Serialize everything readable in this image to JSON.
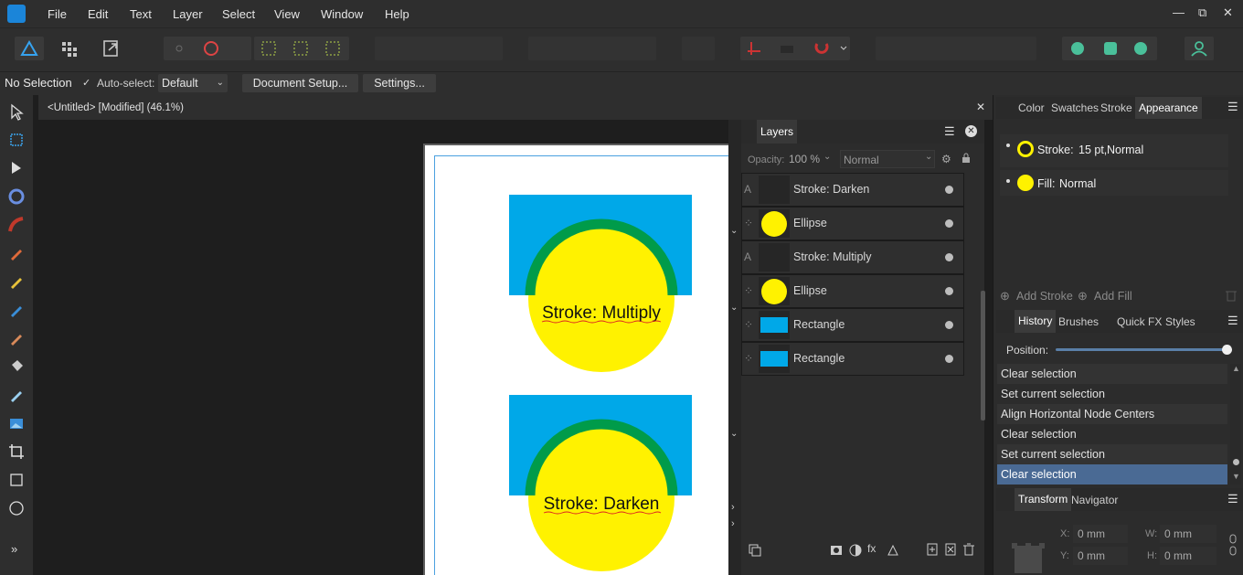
{
  "menu": {
    "items": [
      "File",
      "Edit",
      "Text",
      "Layer",
      "Select",
      "View",
      "Window",
      "Help"
    ],
    "window_controls": [
      "—",
      "⧉",
      "✕"
    ]
  },
  "context_bar": {
    "selection_status": "No Selection",
    "auto_select_label": "Auto-select:",
    "auto_select_checked": true,
    "auto_select_value": "Default",
    "document_setup_label": "Document Setup...",
    "settings_label": "Settings..."
  },
  "document_tab": {
    "title": "<Untitled> [Modified] (46.1%)",
    "close_glyph": "✕"
  },
  "canvas": {
    "shapes": [
      {
        "label": "Stroke: Multiply",
        "rect_color": "#00a8e8",
        "circle_color": "#fff200",
        "stroke_color": "#009b4a"
      },
      {
        "label": "Stroke: Darken",
        "rect_color": "#00a8e8",
        "circle_color": "#fff200",
        "stroke_color": "#009b4a"
      }
    ]
  },
  "layers_panel": {
    "title": "Layers",
    "opacity_label": "Opacity:",
    "opacity_value": "100 %",
    "blend_mode": "Normal",
    "rows": [
      {
        "type_glyph": "A",
        "name": "Stroke: Darken",
        "thumb": "text"
      },
      {
        "type_glyph": "⁘",
        "name": "Ellipse",
        "thumb": "ellipse"
      },
      {
        "type_glyph": "A",
        "name": "Stroke: Multiply",
        "thumb": "text"
      },
      {
        "type_glyph": "⁘",
        "name": "Ellipse",
        "thumb": "ellipse"
      },
      {
        "type_glyph": "⁘",
        "name": "Rectangle",
        "thumb": "rect"
      },
      {
        "type_glyph": "⁘",
        "name": "Rectangle",
        "thumb": "rect"
      }
    ]
  },
  "appearance_panel": {
    "tabs": [
      "Color",
      "Swatches",
      "Stroke",
      "Appearance"
    ],
    "active_tab": "Appearance",
    "stroke_label": "Stroke:",
    "stroke_value": "15 pt,",
    "stroke_mode": "Normal",
    "fill_label": "Fill:",
    "fill_mode": "Normal",
    "add_stroke_label": "Add Stroke",
    "add_fill_label": "Add Fill"
  },
  "history_panel": {
    "tabs": [
      "History",
      "Brushes",
      "Quick FX",
      "Styles"
    ],
    "active_tab": "History",
    "position_label": "Position:",
    "position_fraction": 1.0,
    "entries": [
      "Clear selection",
      "Set current selection",
      "Align Horizontal Node Centers",
      "Clear selection",
      "Set current selection",
      "Clear selection"
    ],
    "selected_index": 5
  },
  "transform_panel": {
    "tabs": [
      "Transform",
      "Navigator"
    ],
    "active_tab": "Transform",
    "x_label": "X:",
    "x_value": "0 mm",
    "y_label": "Y:",
    "y_value": "0 mm",
    "w_label": "W:",
    "w_value": "0 mm",
    "h_label": "H:",
    "h_value": "0 mm"
  },
  "colors": {
    "accent": "#4a6a94",
    "panel_bg": "#2c2c2c",
    "yellow": "#fff200",
    "blue": "#00a8e8",
    "green": "#009b4a"
  }
}
